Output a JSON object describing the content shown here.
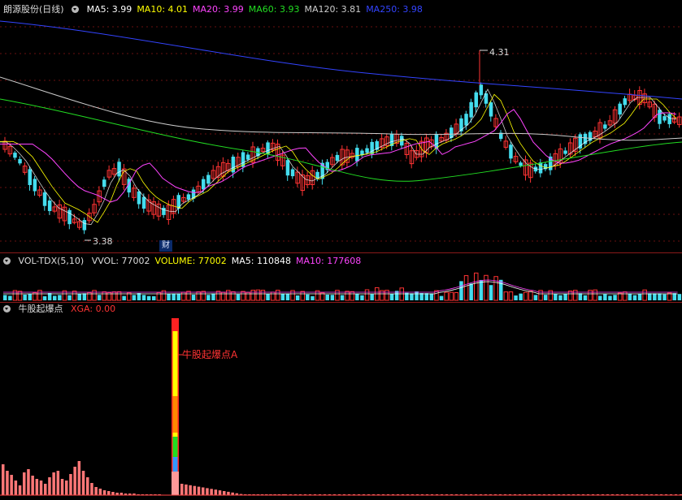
{
  "main_panel": {
    "title": "朗源股份(日线)",
    "ma": [
      {
        "label": "MA5: 3.99",
        "color": "#ffffff"
      },
      {
        "label": "MA10: 4.01",
        "color": "#ffff00"
      },
      {
        "label": "MA20: 3.99",
        "color": "#ff44ff"
      },
      {
        "label": "MA60: 3.93",
        "color": "#22dd22"
      },
      {
        "label": "MA120: 3.81",
        "color": "#cccccc"
      },
      {
        "label": "MA250: 3.98",
        "color": "#3344ff"
      }
    ],
    "high_label": "4.31",
    "low_label": "3.38",
    "finance_badge": "财"
  },
  "volume_panel": {
    "title": "VOL-TDX(5,10)",
    "items": [
      {
        "label": "VVOL: 77002",
        "color": "#dddddd"
      },
      {
        "label": "VOLUME: 77002",
        "color": "#ffff00"
      },
      {
        "label": "MA5: 110848",
        "color": "#ffffff"
      },
      {
        "label": "MA10: 177608",
        "color": "#ff44ff"
      }
    ]
  },
  "indicator_panel": {
    "title": "牛股起爆点",
    "xga_label": "XGA: 0.00",
    "xga_color": "#ff3333",
    "signal_label": "牛股起爆点A",
    "signal_color": "#ff3333"
  },
  "colors": {
    "up": "#ff3333",
    "down": "#44ddee",
    "grid": "#6a1010"
  }
}
